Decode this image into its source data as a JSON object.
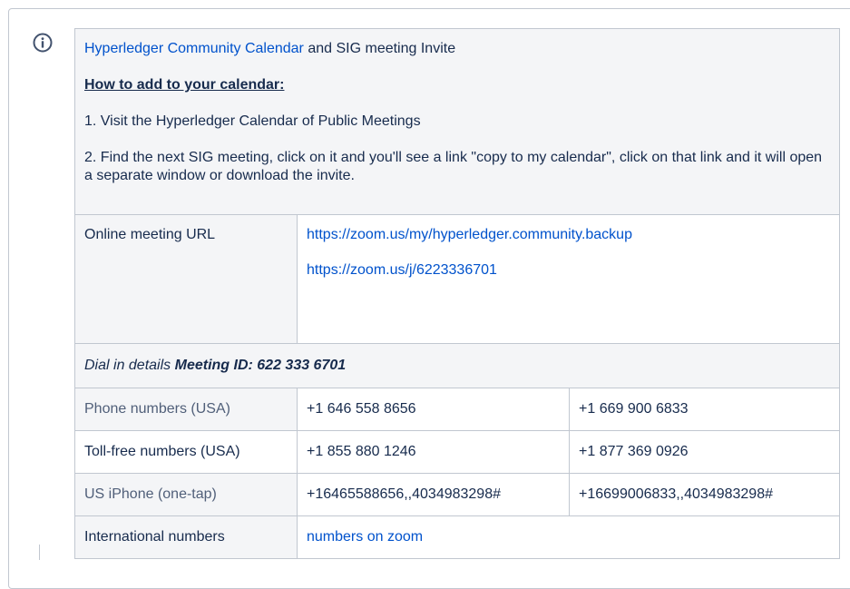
{
  "intro": {
    "calendar_link": "Hyperledger Community Calendar",
    "calendar_suffix": " and SIG meeting Invite",
    "how_to_heading": "How to add to your calendar:",
    "step1": "1. Visit the Hyperledger Calendar of Public Meetings",
    "step2": "2. Find the next SIG meeting, click on it and you'll see a link \"copy to my calendar\", click on that link and it will open a separate window or download the invite."
  },
  "online": {
    "label": "Online meeting URL",
    "url1": "https://zoom.us/my/hyperledger.community.backup",
    "url2": "https://zoom.us/j/6223336701"
  },
  "dial": {
    "prefix": "Dial in details ",
    "meeting_id": "Meeting ID: 622 333 6701"
  },
  "numbers": [
    {
      "label": "Phone numbers (USA)",
      "a": "+1 646 558 8656",
      "b": "+1 669 900 6833"
    },
    {
      "label": "Toll-free numbers (USA)",
      "a": "+1 855 880 1246",
      "b": "+1 877 369 0926"
    },
    {
      "label": "US iPhone (one-tap)",
      "a": "+16465588656,,4034983298#",
      "b": "+16699006833,,4034983298#"
    }
  ],
  "international": {
    "label": "International numbers",
    "link": "numbers on zoom"
  },
  "icons": {
    "info": "info-icon"
  },
  "colors": {
    "link": "#0052cc",
    "border": "#c1c7d0",
    "header_bg": "#f4f5f7"
  }
}
